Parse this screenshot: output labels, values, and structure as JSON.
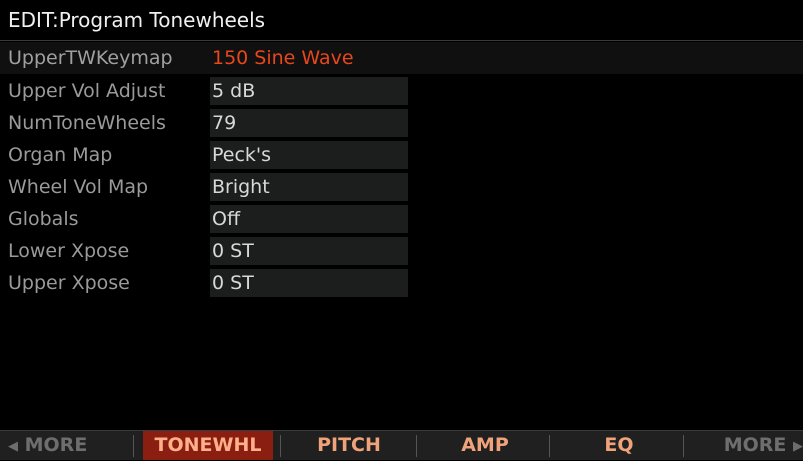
{
  "title": "EDIT:Program Tonewheels",
  "params": [
    {
      "label": "UpperTWKeymap",
      "value": "150 Sine Wave"
    },
    {
      "label": "Upper Vol Adjust",
      "value": "5 dB"
    },
    {
      "label": "NumToneWheels",
      "value": "79"
    },
    {
      "label": "Organ Map",
      "value": "Peck's"
    },
    {
      "label": "Wheel Vol Map",
      "value": "Bright"
    },
    {
      "label": "Globals",
      "value": "Off"
    },
    {
      "label": "Lower Xpose",
      "value": "0 ST"
    },
    {
      "label": "Upper Xpose",
      "value": "0 ST"
    }
  ],
  "softbuttons": {
    "more_left": "MORE",
    "more_left_icon": "left-arrow-icon",
    "tonewhl": "TONEWHL",
    "pitch": "PITCH",
    "amp": "AMP",
    "eq": "EQ",
    "more_right": "MORE",
    "more_right_icon": "right-arrow-icon"
  },
  "colors": {
    "selected_value": "#e8461c",
    "active_tab_bg": "#8a1e10",
    "tab_text": "#f0a27a"
  }
}
